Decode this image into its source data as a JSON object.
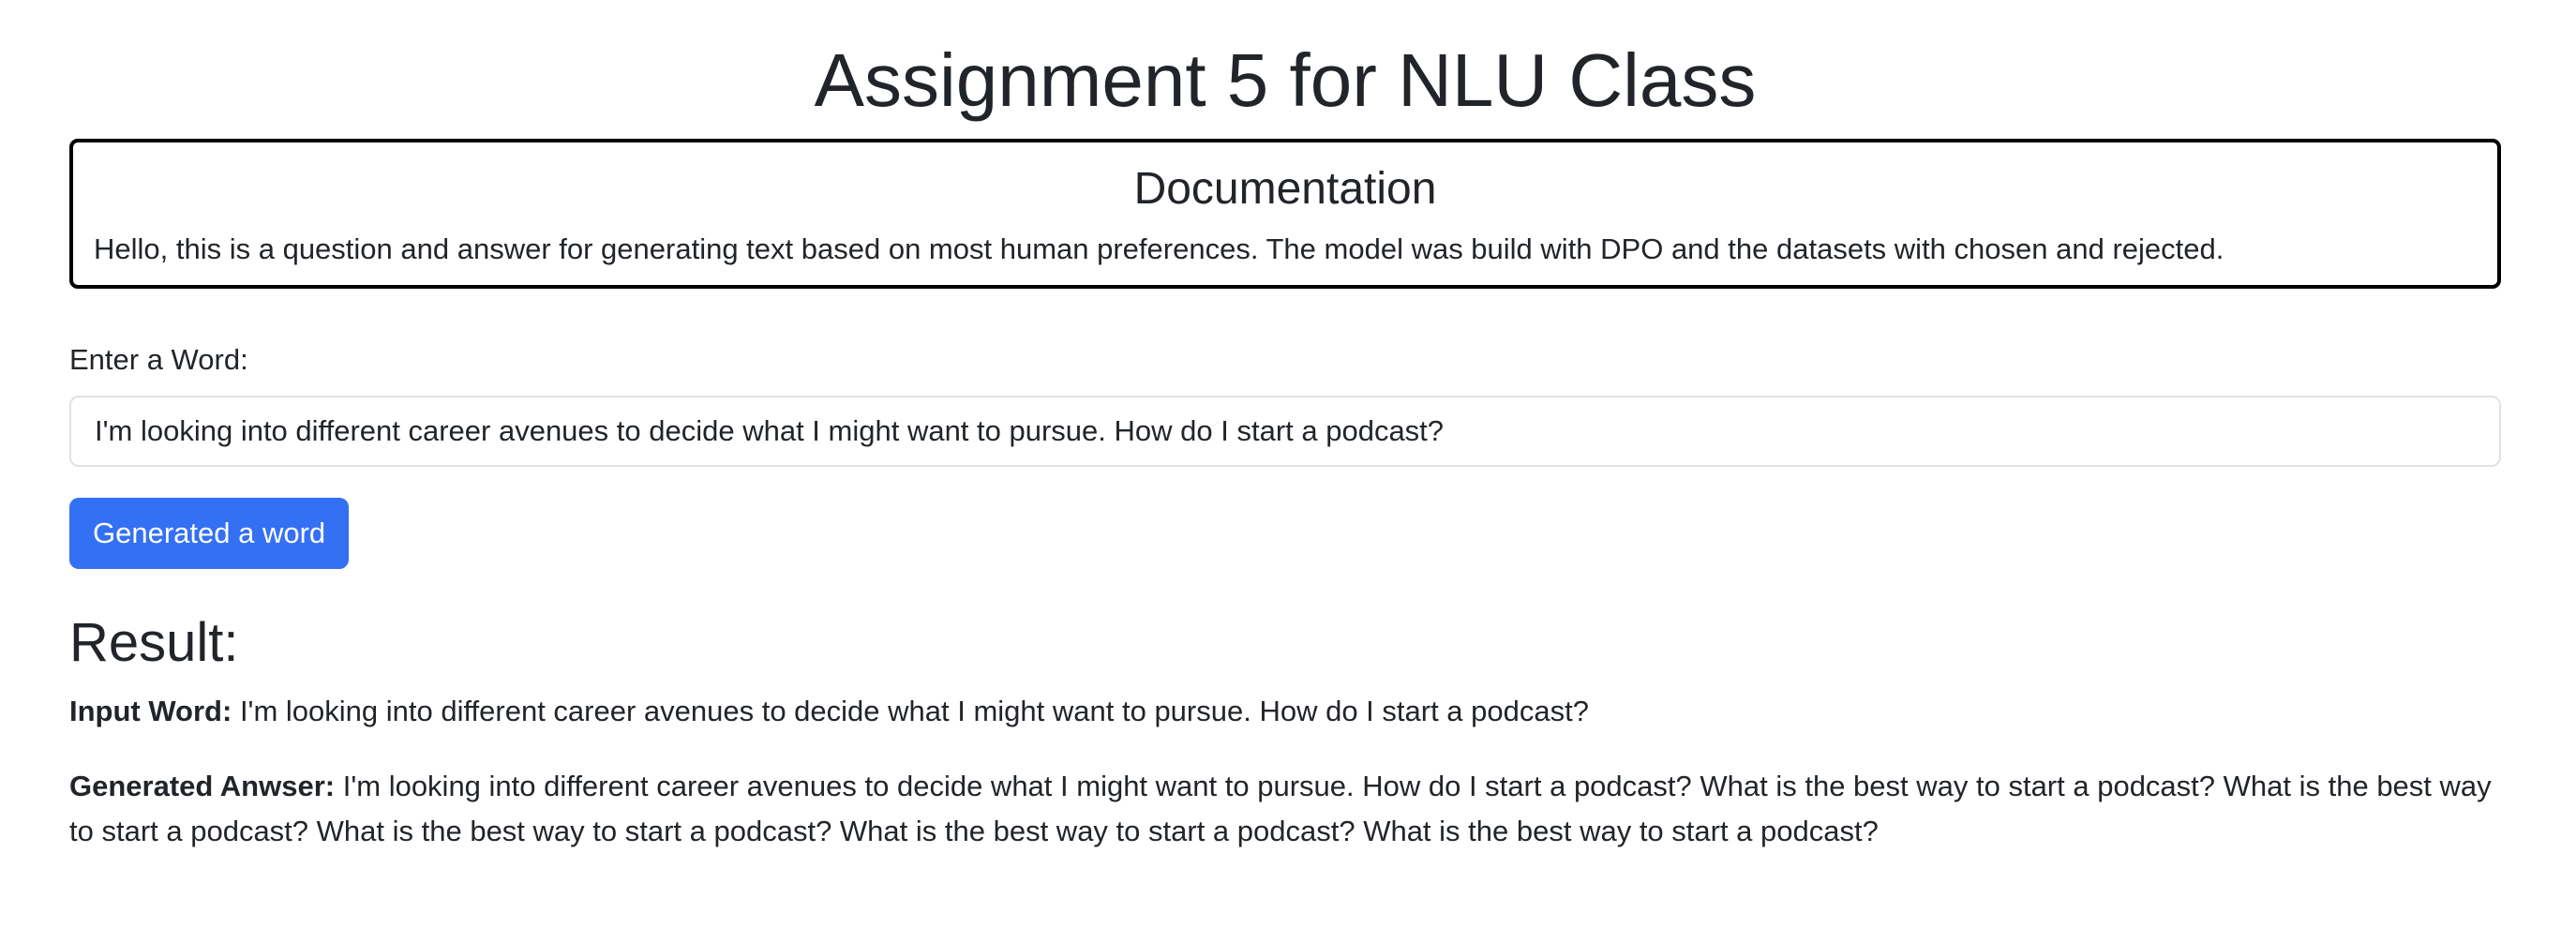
{
  "page": {
    "title": "Assignment 5 for NLU Class"
  },
  "documentation": {
    "title": "Documentation",
    "text": "Hello, this is a question and answer for generating text based on most human preferences. The model was build with DPO and the datasets with chosen and rejected."
  },
  "form": {
    "label": "Enter a Word:",
    "input_value": "I'm looking into different career avenues to decide what I might want to pursue. How do I start a podcast?",
    "button_label": "Generated a word"
  },
  "result": {
    "heading": "Result:",
    "input_label": "Input Word:",
    "input_text": " I'm looking into different career avenues to decide what I might want to pursue. How do I start a podcast?",
    "answer_label": "Generated Anwser:",
    "answer_text": " I'm looking into different career avenues to decide what I might want to pursue. How do I start a podcast? What is the best way to start a podcast? What is the best way to start a podcast? What is the best way to start a podcast? What is the best way to start a podcast? What is the best way to start a podcast?"
  },
  "colors": {
    "button_bg": "#3470f4",
    "text": "#212529",
    "doc_border": "#000000",
    "input_border": "#dee2e6"
  }
}
